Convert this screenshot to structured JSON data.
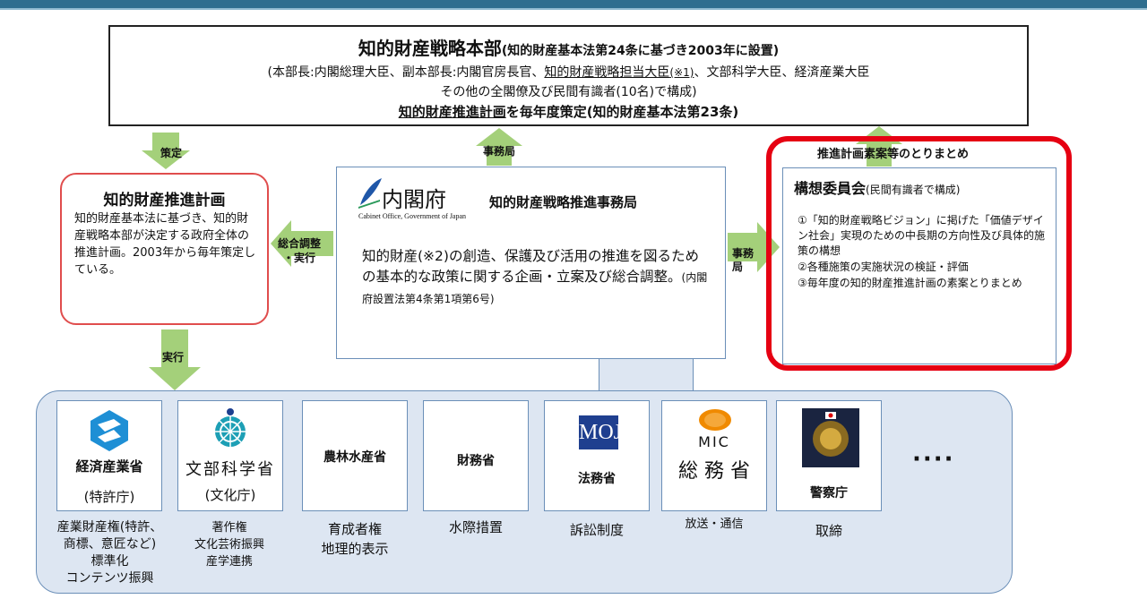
{
  "hq": {
    "title": "知的財産戦略本部",
    "title_note": "(知的財産基本法第24条に基づき2003年に設置)",
    "line2_a": "(本部長:内閣総理大臣、副本部長:内閣官房長官、",
    "line2_b": "知的財産戦略担当大臣",
    "line2_c": "(※1)",
    "line2_d": "、文部科学大臣、経済産業大臣",
    "line3": "その他の全閣僚及び民間有識者(10名)で構成)",
    "line4_a": "知的財産推進計画",
    "line4_b": "を毎年度策定(知的財産基本法第23条)"
  },
  "arrows": {
    "sakutei": "策定",
    "jimukyoku_up": "事務局",
    "sogo_line1": "総合調整",
    "sogo_line2": "・実行",
    "jimukyoku_right_1": "事務",
    "jimukyoku_right_2": "局",
    "jikko": "実行",
    "torimatome": "推進計画素案等のとりまとめ"
  },
  "plan": {
    "title": "知的財産推進計画",
    "desc": "知的財産基本法に基づき、知的財産戦略本部が決定する政府全体の推進計画。2003年から毎年策定している。"
  },
  "center": {
    "logo_text": "内閣府",
    "logo_sub": "Cabinet Office, Government of Japan",
    "secretariat": "知的財産戦略推進事務局",
    "body": "知的財産(※2)の創造、保護及び活用の推進を図るための基本的な政策に関する企画・立案及び総合調整。",
    "body_note": "(内閣府設置法第4条第1項第6号)"
  },
  "committee": {
    "title": "構想委員会",
    "title_note": "(民間有識者で構成)",
    "items": [
      "①「知的財産戦略ビジョン」に掲げた「価値デザイン社会」実現のための中長期の方向性及び具体的施策の構想",
      "②各種施策の実施状況の検証・評価",
      "③毎年度の知的財産推進計画の素案とりまとめ"
    ]
  },
  "ministries": [
    {
      "name": "経済産業省",
      "sub": "(特許庁)",
      "desc": [
        "産業財産権(特許、",
        "商標、意匠など)",
        "標準化",
        "コンテンツ振興"
      ],
      "icon": "meti-logo-icon",
      "color": "#1e8fd5"
    },
    {
      "name": "文部科学省",
      "sub": "(文化庁)",
      "desc": [
        "著作権",
        "文化芸術振興",
        "産学連携"
      ],
      "icon": "mext-logo-icon",
      "color": "#1d9fb5"
    },
    {
      "name": "農林水産省",
      "sub": "",
      "desc": [
        "育成者権",
        "地理的表示"
      ],
      "icon": "",
      "color": ""
    },
    {
      "name": "財務省",
      "sub": "",
      "desc": [
        "水際措置"
      ],
      "icon": "",
      "color": ""
    },
    {
      "name": "法務省",
      "sub": "",
      "desc": [
        "訴訟制度"
      ],
      "icon": "moj-logo-icon",
      "color": "#1f3f8f"
    },
    {
      "name": "総 務 省",
      "sub": "MIC",
      "desc": [
        "放送・通信"
      ],
      "icon": "mic-logo-icon",
      "color": "#f08a00"
    },
    {
      "name": "警察庁",
      "sub": "",
      "desc": [
        "取締"
      ],
      "icon": "npa-emblem-icon",
      "color": "#1a2440"
    }
  ],
  "more": "····"
}
